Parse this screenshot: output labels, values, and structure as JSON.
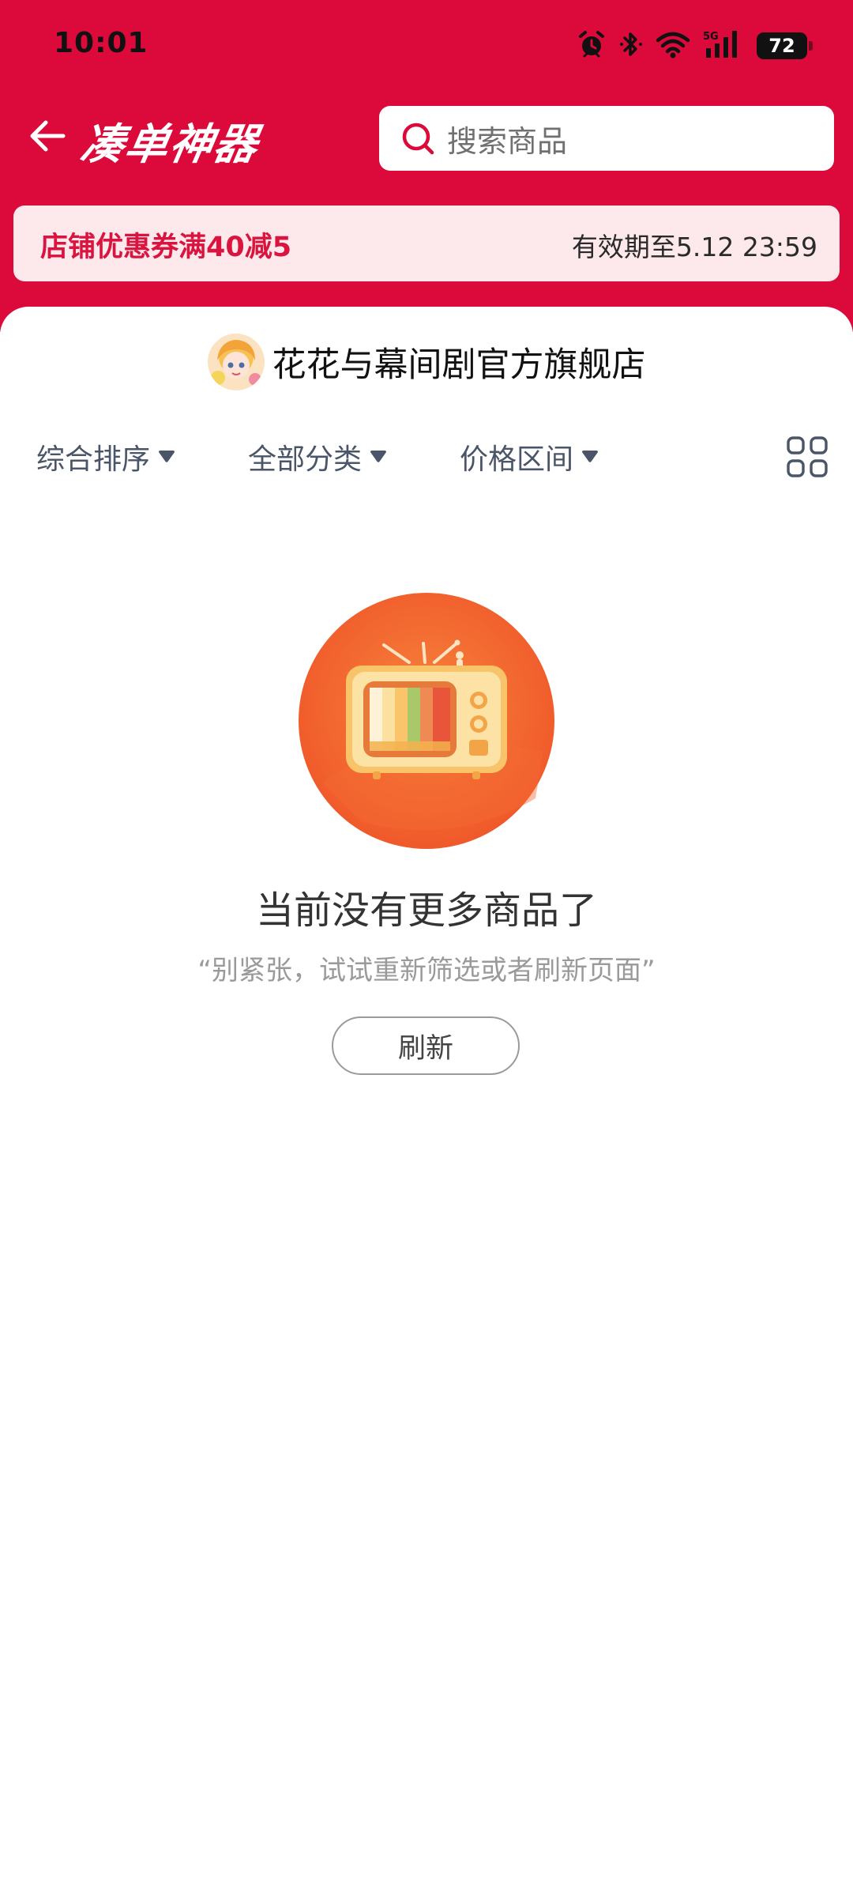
{
  "status_bar": {
    "time": "10:01",
    "battery_level": "72",
    "network_type": "5G",
    "icons": [
      "alarm-icon",
      "bluetooth-icon",
      "wifi-icon",
      "signal-icon",
      "battery-icon"
    ]
  },
  "nav": {
    "back_icon": "back-arrow-icon",
    "app_logo": "凑单神器",
    "search_placeholder": "搜索商品",
    "search_icon": "search-icon"
  },
  "coupon": {
    "title": "店铺优惠券满40减5",
    "expiry": "有效期至5.12 23:59"
  },
  "shop": {
    "name": "花花与幕间剧官方旗舰店",
    "avatar_icon": "shop-avatar"
  },
  "filters": [
    {
      "label": "综合排序",
      "icon": "caret-down-icon"
    },
    {
      "label": "全部分类",
      "icon": "caret-down-icon"
    },
    {
      "label": "价格区间",
      "icon": "caret-down-icon"
    }
  ],
  "layout_toggle_icon": "grid-view-icon",
  "empty_state": {
    "illustration": "tv-icon",
    "title": "当前没有更多商品了",
    "hint": "“别紧张，试试重新筛选或者刷新页面”",
    "refresh_label": "刷新"
  },
  "colors": {
    "header_red": "#dc0a3b",
    "coupon_bg": "#fde8ec",
    "coupon_text": "#d9143f",
    "filter_text": "#4a5568"
  }
}
